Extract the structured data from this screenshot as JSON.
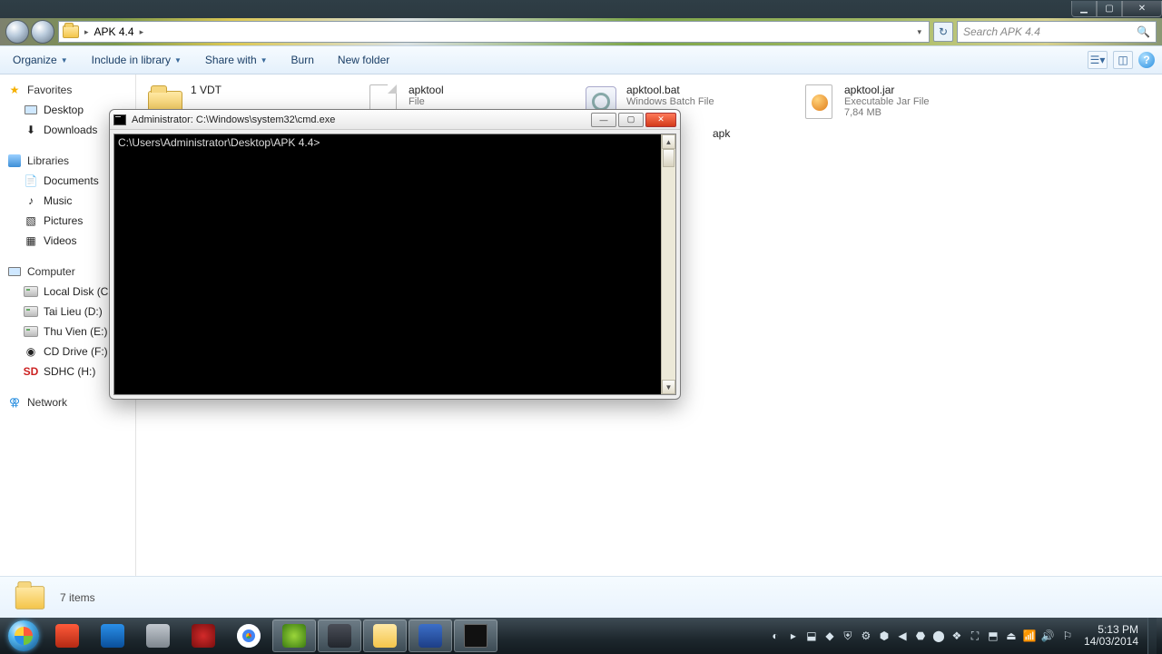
{
  "window_caption": {
    "min": "▁",
    "max": "▢",
    "close": "✕"
  },
  "address": {
    "crumb_root": "▸",
    "crumb_folder": "APK 4.4",
    "crumb_after": "▸"
  },
  "search": {
    "placeholder": "Search APK 4.4",
    "icon": "🔍"
  },
  "toolbar": {
    "organize": "Organize",
    "include": "Include in library",
    "share": "Share with",
    "burn": "Burn",
    "newfolder": "New folder",
    "help": "?"
  },
  "sidebar": {
    "favorites": {
      "label": "Favorites",
      "items": [
        {
          "icon": "desktop",
          "label": "Desktop"
        },
        {
          "icon": "downloads",
          "label": "Downloads"
        }
      ]
    },
    "libraries": {
      "label": "Libraries",
      "items": [
        {
          "icon": "doc",
          "label": "Documents"
        },
        {
          "icon": "music",
          "label": "Music"
        },
        {
          "icon": "pic",
          "label": "Pictures"
        },
        {
          "icon": "vid",
          "label": "Videos"
        }
      ]
    },
    "computer": {
      "label": "Computer",
      "items": [
        {
          "icon": "drive",
          "label": "Local Disk (C:)"
        },
        {
          "icon": "drive",
          "label": "Tai Lieu (D:)"
        },
        {
          "icon": "drive",
          "label": "Thu Vien (E:)"
        },
        {
          "icon": "cd",
          "label": "CD Drive (F:)"
        },
        {
          "icon": "sd",
          "label": "SDHC (H:)"
        }
      ]
    },
    "network": {
      "label": "Network"
    }
  },
  "files": [
    {
      "icon": "folder",
      "name": "1 VDT",
      "l2": "",
      "l3": ""
    },
    {
      "icon": "doc",
      "name": "apktool",
      "l2": "File",
      "l3": ""
    },
    {
      "icon": "bat",
      "name": "apktool.bat",
      "l2": "Windows Batch File",
      "l3": ""
    },
    {
      "icon": "jar",
      "name": "apktool.jar",
      "l2": "Executable Jar File",
      "l3": "7,84 MB"
    }
  ],
  "partial_file_label": "apk",
  "status": {
    "text": "7 items"
  },
  "cmd": {
    "title": "Administrator: C:\\Windows\\system32\\cmd.exe",
    "prompt": "C:\\Users\\Administrator\\Desktop\\APK 4.4>",
    "btn_min": "—",
    "btn_max": "▢",
    "btn_close": "✕",
    "sb_up": "▲",
    "sb_down": "▼"
  },
  "taskbar": {
    "items": [
      {
        "name": "ccleaner",
        "bg": "linear-gradient(#ff5a3a,#b42a14)"
      },
      {
        "name": "app-blue",
        "bg": "linear-gradient(#2a8fe8,#0a4f9a)"
      },
      {
        "name": "task-manager",
        "bg": "linear-gradient(#c2c8cf,#7e868e)"
      },
      {
        "name": "lg",
        "bg": "radial-gradient(circle at 50% 50%,#d32a2a,#7a0f0f)"
      },
      {
        "name": "chrome",
        "bg": "conic-gradient(#ea4335 0 120deg,#34a853 120deg 240deg,#fbbc05 240deg 360deg)"
      },
      {
        "name": "utorrent",
        "bg": "radial-gradient(circle at 50% 50%,#9bd63a,#3a7a12)",
        "active": true
      },
      {
        "name": "app-dark",
        "bg": "linear-gradient(#4b4f58,#22262d)",
        "active": true
      },
      {
        "name": "explorer",
        "bg": "linear-gradient(#ffe9a6,#f4c54a)",
        "active": true
      },
      {
        "name": "word",
        "bg": "linear-gradient(#3c6fc8,#1d3e86)",
        "active": true
      },
      {
        "name": "cmd",
        "bg": "#111",
        "active": true
      }
    ],
    "tray_icons": [
      "◐",
      "▸",
      "⬓",
      "◆",
      "⛨",
      "⚙",
      "⬢",
      "◀",
      "⬣",
      "⬤",
      "❖",
      "⛶",
      "⬒",
      "⏏",
      "📶",
      "🔊"
    ],
    "flag": "⚐",
    "time": "5:13 PM",
    "date": "14/03/2014"
  }
}
